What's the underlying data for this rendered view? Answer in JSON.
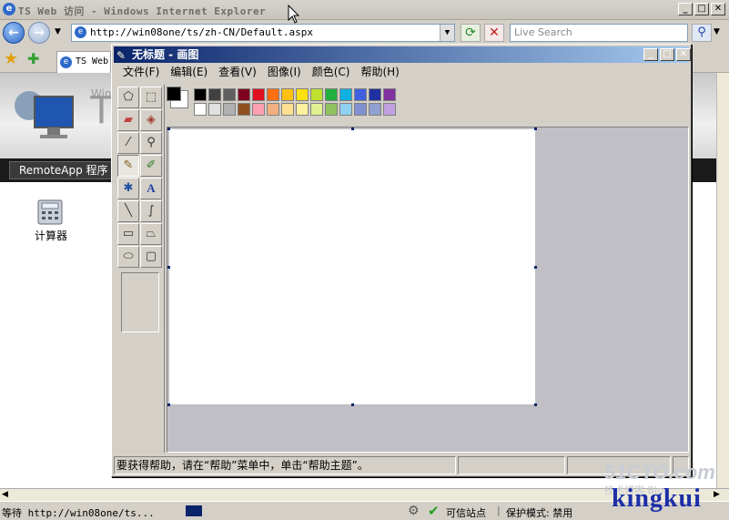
{
  "ie": {
    "title": "TS Web 访问 - Windows Internet Explorer",
    "address": "http://win08one/ts/zh-CN/Default.aspx",
    "search_placeholder": "Live Search",
    "tab_label": "TS Web",
    "window_buttons": [
      "_",
      "□",
      "✕"
    ]
  },
  "ts_page": {
    "logo_text": "T",
    "logo_small": "Win",
    "nav_item": "RemoteApp 程序",
    "program_label": "计算器"
  },
  "paint": {
    "title": "无标题 - 画图",
    "menu": [
      "文件(F)",
      "编辑(E)",
      "查看(V)",
      "图像(I)",
      "颜色(C)",
      "帮助(H)"
    ],
    "window_buttons": [
      "_",
      "□",
      "✕"
    ],
    "status_text": "要获得帮助，请在“帮助”菜单中，单击“帮助主题”。",
    "palette_top": [
      "#000000",
      "#404040",
      "#606060",
      "#800020",
      "#e01020",
      "#ff7010",
      "#ffc010",
      "#ffe010",
      "#c0e030",
      "#20b040",
      "#10b0e0",
      "#4060e0",
      "#2030a0",
      "#8030a0"
    ],
    "palette_bottom": [
      "#ffffff",
      "#e0e0e0",
      "#b0b0b0",
      "#905020",
      "#ffa0b0",
      "#f0b080",
      "#ffe090",
      "#fff0a0",
      "#e0f090",
      "#90c060",
      "#90d0f0",
      "#8090d0",
      "#90a0d0",
      "#c0a0e0"
    ],
    "fg_color": "#000000",
    "bg_color": "#ffffff"
  },
  "status": {
    "text": "等待 http://win08one/ts...",
    "zone": "可信站点",
    "protected_mode": "保护模式: 禁用"
  },
  "watermark": {
    "site": "51CTO.com",
    "blog": "技术博客 Blog",
    "author": "kingkui"
  }
}
